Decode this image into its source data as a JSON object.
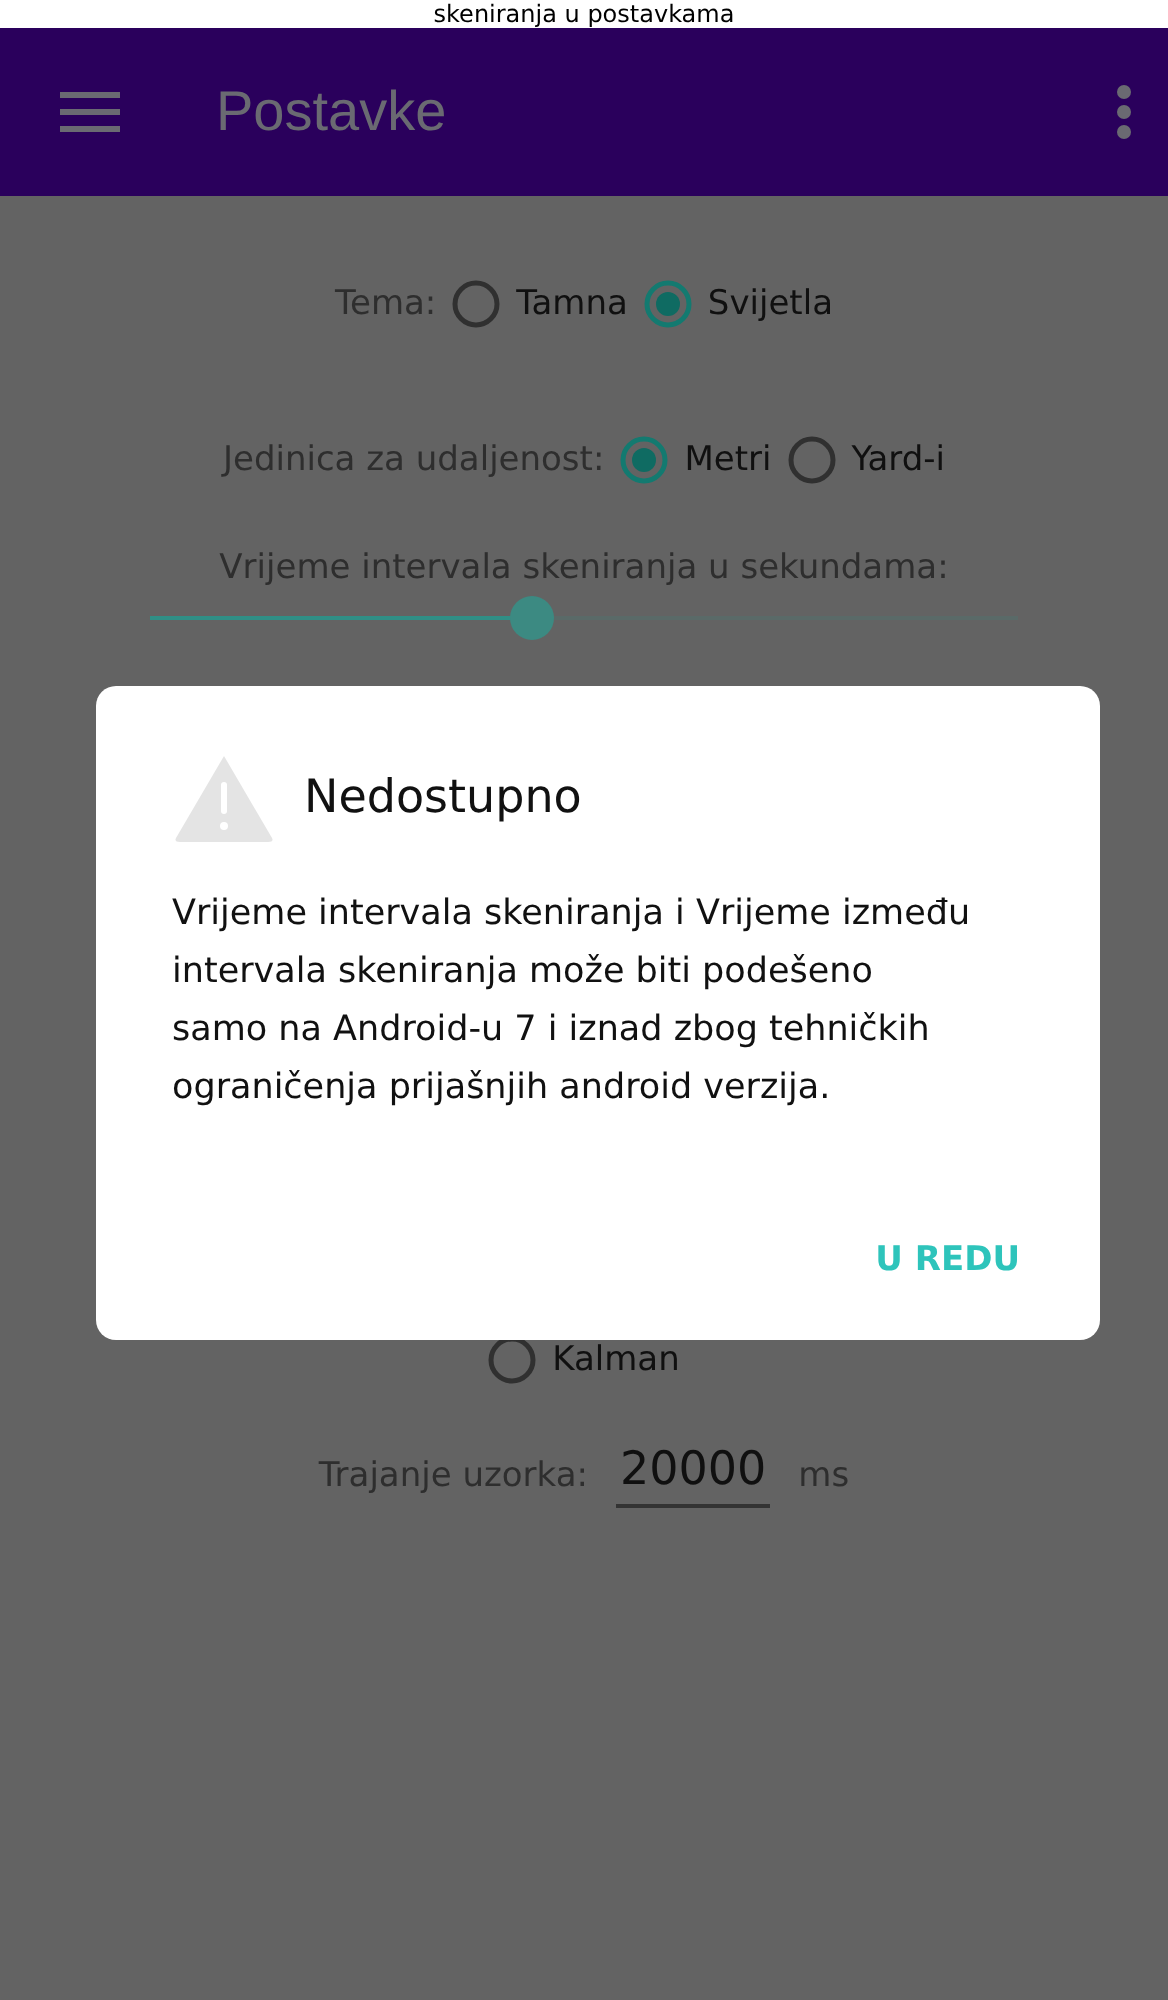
{
  "caption": "skeniranja u postavkama",
  "app_bar": {
    "title": "Postavke"
  },
  "theme": {
    "label": "Tema:",
    "options": [
      {
        "label": "Tamna",
        "selected": false
      },
      {
        "label": "Svijetla",
        "selected": true
      }
    ]
  },
  "distance_unit": {
    "label": "Jedinica za udaljenost:",
    "options": [
      {
        "label": "Metri",
        "selected": true
      },
      {
        "label": "Yard-i",
        "selected": false
      }
    ]
  },
  "scan_interval": {
    "label": "Vrijeme intervala skeniranja u sekundama:",
    "level": 0.44
  },
  "filter": {
    "options": [
      {
        "label": "Kalman",
        "selected": false
      }
    ]
  },
  "sample_duration": {
    "label": "Trajanje uzorka:",
    "value": "20000",
    "unit": "ms"
  },
  "dialog": {
    "title": "Nedostupno",
    "message": "Vrijeme intervala skeniranja i Vrijeme između intervala skeniranja može biti podešeno samo na Android-u 7 i iznad zbog tehničkih ograničenja prijašnjih android verzija.",
    "button": "U REDU"
  }
}
